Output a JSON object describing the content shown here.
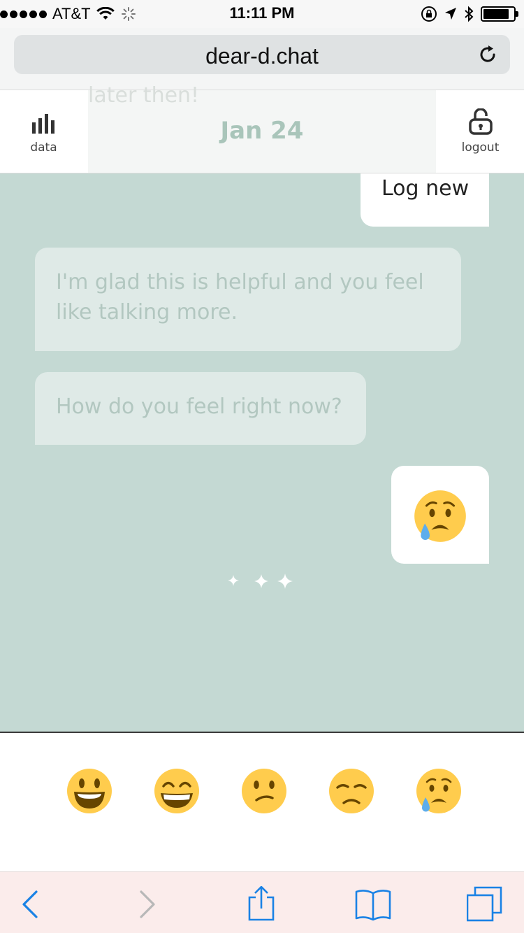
{
  "status_bar": {
    "carrier": "AT&T",
    "time": "11:11 PM",
    "signal_bars": 5
  },
  "browser": {
    "url": "dear-d.chat",
    "reload_icon": "reload-icon"
  },
  "header": {
    "date": "Jan 24",
    "ghost_text": "later then!",
    "data_label": "data",
    "logout_label": "logout",
    "data_icon": "bar-chart-icon",
    "logout_icon": "unlock-icon",
    "title_color": "#a9c5ba"
  },
  "chat": {
    "background_color": "#c4d9d3",
    "log_new": "Log new",
    "messages": [
      {
        "from": "bot",
        "text": "I'm glad this is helpful and you feel like talking more."
      },
      {
        "from": "bot",
        "text": "How do you feel right now?"
      }
    ],
    "user_emoji": "crying-face-icon",
    "typing_indicator": "sparkles-icon"
  },
  "mood_options": [
    {
      "icon": "smiley-face-icon",
      "mood": "happy"
    },
    {
      "icon": "grinning-face-icon",
      "mood": "very-happy"
    },
    {
      "icon": "confused-face-icon",
      "mood": "confused"
    },
    {
      "icon": "unamused-face-icon",
      "mood": "unamused"
    },
    {
      "icon": "crying-face-icon",
      "mood": "sad"
    }
  ],
  "toolbar": {
    "accent_color": "#1a82e5",
    "items": [
      "back-icon",
      "forward-icon",
      "share-icon",
      "bookmarks-icon",
      "tabs-icon"
    ]
  }
}
